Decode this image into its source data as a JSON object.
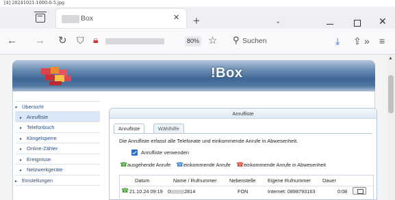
{
  "file_label": "[4] 20241021-1000-0-5.jpg",
  "browser": {
    "tab": {
      "title": "Box",
      "close": "×"
    },
    "new_tab": "+",
    "tab_overflow": "⌄",
    "window": {
      "close": "✕"
    },
    "nav": {
      "back": "←",
      "forward": "→",
      "reload": "↻"
    },
    "zoom": "80%",
    "search_placeholder": "Suchen",
    "toolbar": {
      "download": "⤓",
      "share": "⇪",
      "more": "»",
      "menu": "≡"
    },
    "icons": [
      "tab-list-icon",
      "shield-icon",
      "permissions-icon",
      "bookmark-star-icon",
      "search-icon",
      "download-icon",
      "extensions-icon",
      "overflow-icon",
      "menu-icon"
    ]
  },
  "page": {
    "brand": "!Box",
    "nav": [
      {
        "label": "Übersicht",
        "level": 1,
        "active": false
      },
      {
        "label": "Anrufliste",
        "level": 2,
        "active": true
      },
      {
        "label": "Telefonbuch",
        "level": 2,
        "active": false
      },
      {
        "label": "Klingelsperre",
        "level": 2,
        "active": false
      },
      {
        "label": "Online-Zähler",
        "level": 2,
        "active": false
      },
      {
        "label": "Ereignisse",
        "level": 2,
        "active": false
      },
      {
        "label": "Netzwerkgeräte",
        "level": 2,
        "active": false
      },
      {
        "label": "Einstellungen",
        "level": 1,
        "active": false
      }
    ],
    "panel": {
      "title": "Anrufliste",
      "tabs": [
        "Anrufliste",
        "Wählhilfe"
      ],
      "description": "Die Anrufliste erfasst alle Telefonate und einkommende Anrufe in Abwesenheit.",
      "checkbox_label": "Anrufliste verwenden",
      "checkbox_checked": true,
      "legend": [
        {
          "icon": "outgoing-call-icon",
          "label": "ausgehende Anrufe",
          "color": "#3a9a2a"
        },
        {
          "icon": "incoming-call-icon",
          "label": "einkommende Anrufe",
          "color": "#3a7fd0"
        },
        {
          "icon": "missed-call-icon",
          "label": "einkommende Anrufe in Abwesenheit",
          "color": "#d0402a"
        }
      ],
      "table": {
        "headers": [
          "Datum",
          "Name / Rufnummer",
          "Nebenstelle",
          "Eigene Rufnummer",
          "Dauer"
        ],
        "rows": [
          {
            "date": "21.10.24 09:19",
            "number_prefix": "0",
            "number_suffix": "2814",
            "extension": "FON",
            "own_number": "Internet: 0898793163",
            "duration": "0:08"
          }
        ]
      }
    }
  }
}
